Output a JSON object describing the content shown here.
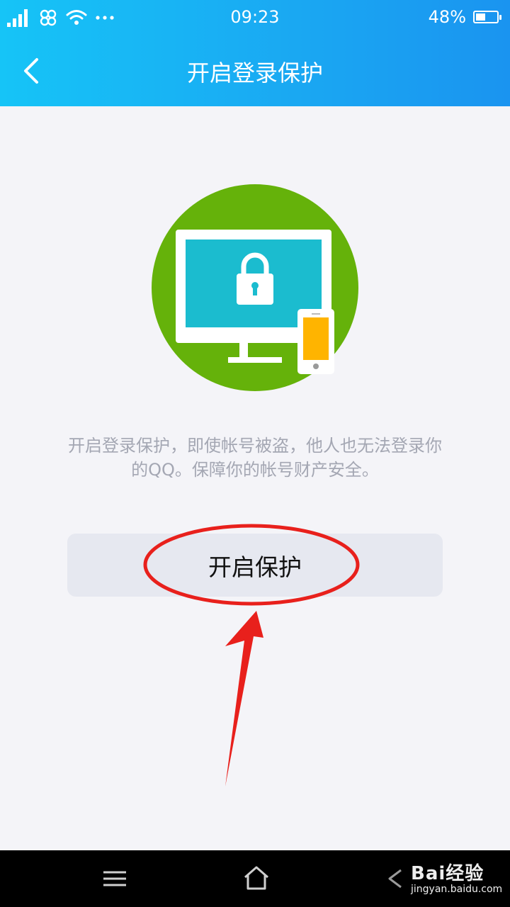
{
  "status_bar": {
    "time": "09:23",
    "battery": "48%",
    "battery_level": 0.48,
    "icons": [
      "signal-icon",
      "unicom-icon",
      "wifi-icon",
      "more-dots-icon",
      "battery-icon"
    ]
  },
  "header": {
    "title": "开启登录保护"
  },
  "illustration": {
    "icon": "monitor-lock-phone-icon",
    "colors": {
      "circle": "#65b20a",
      "screen": "#1bbccf",
      "phone_screen": "#ffb400"
    }
  },
  "main": {
    "description_line1": "开启登录保护，即使帐号被盗，他人也无法登录你",
    "description_line2": "的QQ。保障你的帐号财产安全。",
    "button_label": "开启保护"
  },
  "annotation": {
    "color": "#e8201c",
    "shapes": [
      "ellipse",
      "arrow"
    ]
  },
  "bottom_bar": {
    "watermark_brand": "Bai经验",
    "watermark_url": "jingyan.baidu.com"
  },
  "colors": {
    "header_start": "#16c4f7",
    "header_end": "#1a94f0",
    "background": "#f4f4f8",
    "button_bg": "#e6e8f0"
  }
}
